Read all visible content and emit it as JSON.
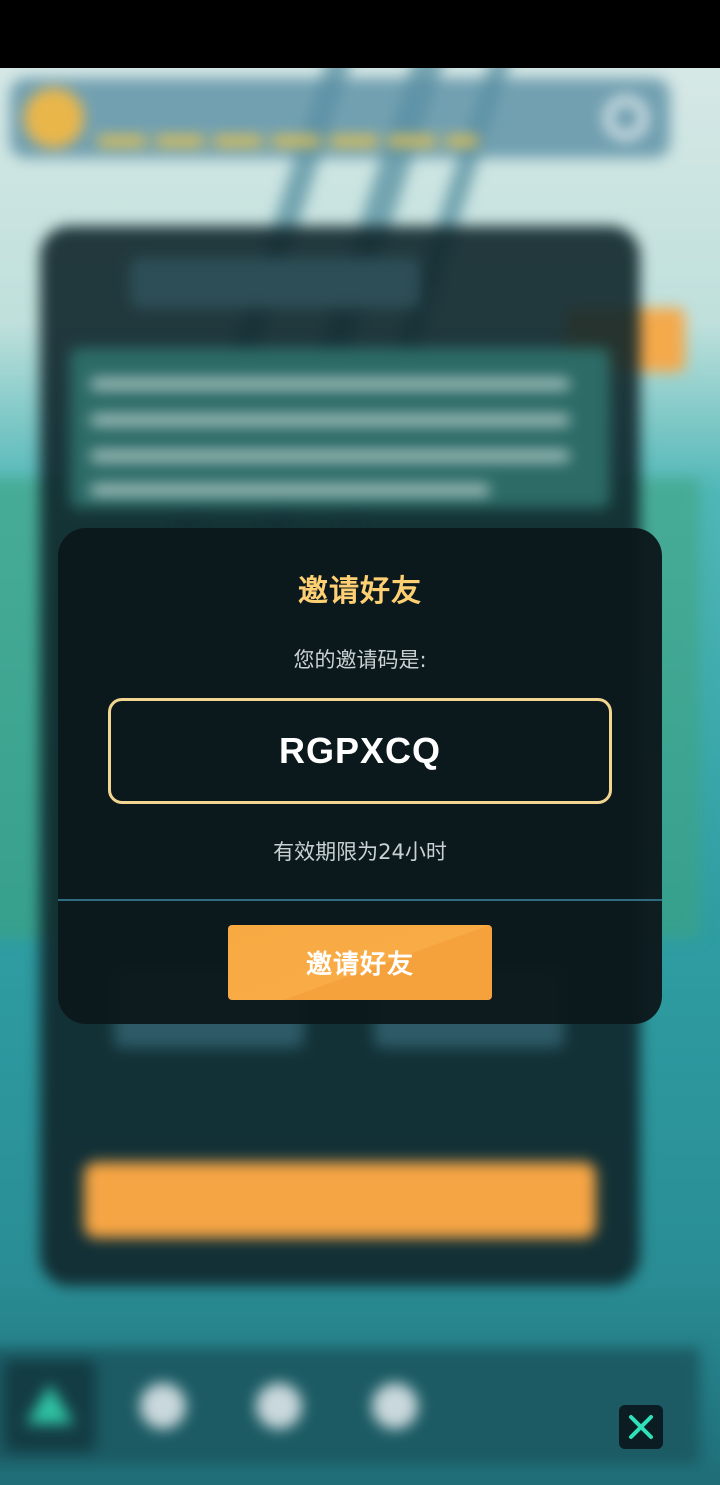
{
  "dialog": {
    "title": "邀请好友",
    "prompt": "您的邀请码是:",
    "invite_code": "RGPXCQ",
    "validity_note": "有效期限为24小时",
    "invite_button_label": "邀请好友"
  },
  "colors": {
    "title": "#ffd073",
    "code_border": "#f1d591",
    "button": "#f7a942",
    "dialog_bg": "#0c181b",
    "divider": "#2f6c82"
  },
  "icons": {
    "close": "close-icon",
    "settings": "gear-icon",
    "nav_home": "triangle-icon"
  }
}
